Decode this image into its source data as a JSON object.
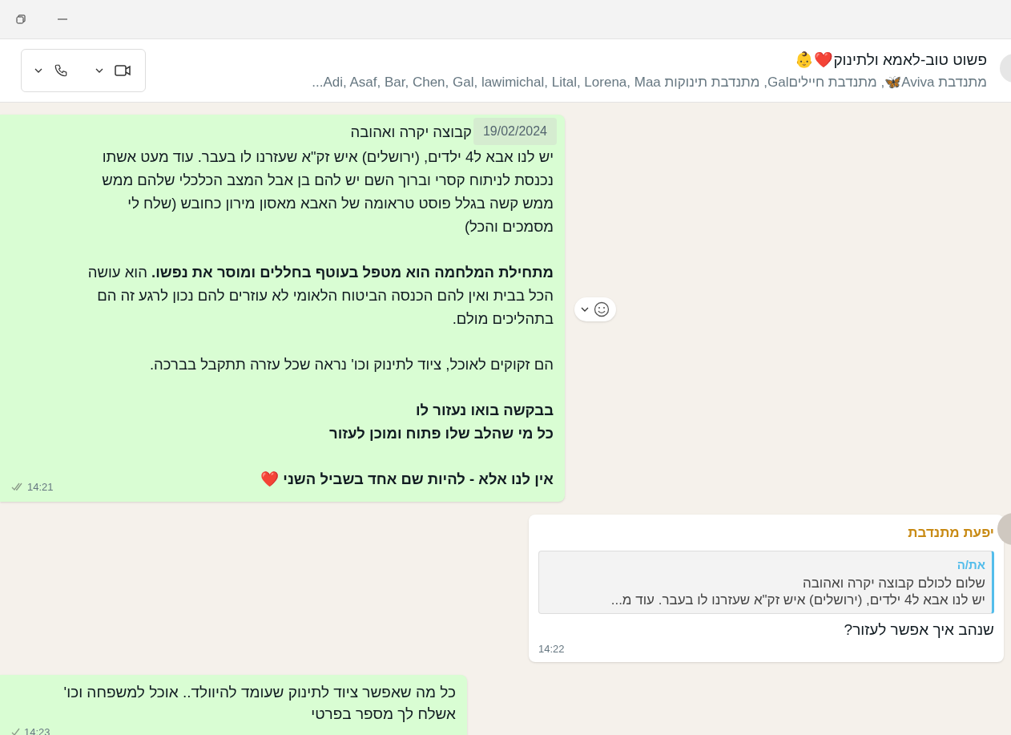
{
  "header": {
    "title": "פשוט טוב-לאמא ולתינוק❤️👶",
    "members": "מתנדבת Aviva🦋, מתנדבת חייליםGal, מתנדבת תינוקות Adi, Asaf, Bar, Chen, Gal, lawimichal, Lital, Lorena, Maa..."
  },
  "date_badge": "19/02/2024",
  "messages": [
    {
      "kind": "outgoing",
      "first_line": "קבוצה יקרה ואהובה",
      "paragraphs": [
        "יש לנו אבא ל4 ילדים, (ירושלים) איש זק\"א שעזרנו לו בעבר. עוד מעט אשתו\nנכנסת לניתוח קסרי  וברוך השם יש להם בן אבל המצב הכלכלי שלהם ממש\nממש קשה בגלל פוסט טראומה של האבא מאסון מירון כחובש (שלח לי\nמסמכים והכל)",
        "**מתחילת המלחמה הוא מטפל בעוטף בחללים ומוסר את נפשו.**  הוא עושה\nהכל בבית ואין להם הכנסה  הביטוח הלאומי לא עוזרים להם נכון לרגע זה הם\nבתהליכים מולם.",
        "הם זקוקים לאוכל, ציוד לתינוק וכו'  נראה שכל עזרה תתקבל בברכה.",
        "**בבקשה בואו נעזור לו\nכל מי שהלב שלו פתוח ומוכן לעזור**",
        "**אין לנו אלא - להיות שם אחד בשביל השני** ❤️"
      ],
      "time": "14:21",
      "double_tick": true
    },
    {
      "kind": "incoming",
      "sender": "יפעת מתנדבת",
      "quote": {
        "sender": "את/ה",
        "lines": [
          "שלום לכולם קבוצה יקרה ואהובה",
          "יש לנו אבא ל4 ילדים, (ירושלים) איש זק\"א שעזרנו לו בעבר. עוד מ..."
        ]
      },
      "paragraphs": [
        "שנהב איך אפשר לעזור?"
      ],
      "time": "14:22"
    },
    {
      "kind": "outgoing",
      "paragraphs": [
        "כל מה שאפשר ציוד לתינוק שעומד להיוולד.. אוכל למשפחה וכו'\nאשלח לך מספר בפרטי"
      ],
      "time": "14:23",
      "double_tick": false
    }
  ]
}
